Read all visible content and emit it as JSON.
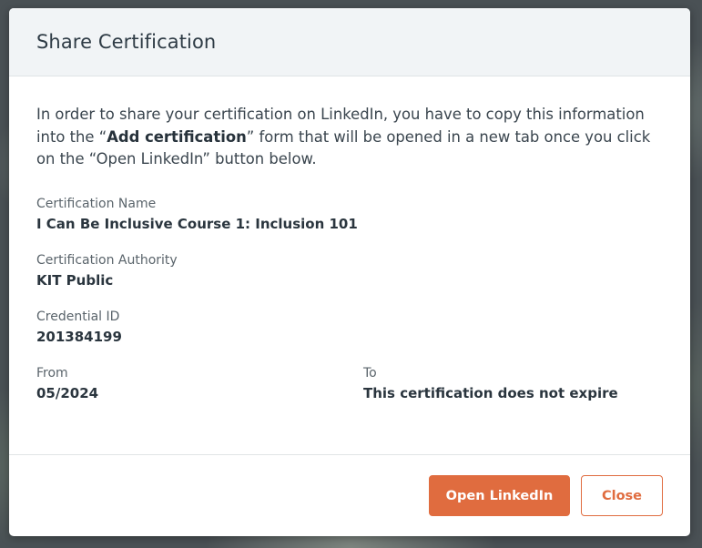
{
  "modal": {
    "title": "Share Certification",
    "intro": {
      "before": "In order to share your certification on LinkedIn, you have to copy this information into the “",
      "bold": "Add certification",
      "after": "” form that will be opened in a new tab once you click on the “Open LinkedIn” button below."
    },
    "fields": {
      "certification_name": {
        "label": "Certification Name",
        "value": "I Can Be Inclusive Course 1: Inclusion 101"
      },
      "certification_authority": {
        "label": "Certification Authority",
        "value": "KIT Public"
      },
      "credential_id": {
        "label": "Credential ID",
        "value": "201384199"
      },
      "from": {
        "label": "From",
        "value": "05/2024"
      },
      "to": {
        "label": "To",
        "value": "This certification does not expire"
      }
    },
    "buttons": {
      "open_linkedin": "Open LinkedIn",
      "close": "Close"
    }
  },
  "colors": {
    "accent": "#e06c3f",
    "header_bg": "#f1f4f6",
    "text_primary": "#2a353e"
  }
}
